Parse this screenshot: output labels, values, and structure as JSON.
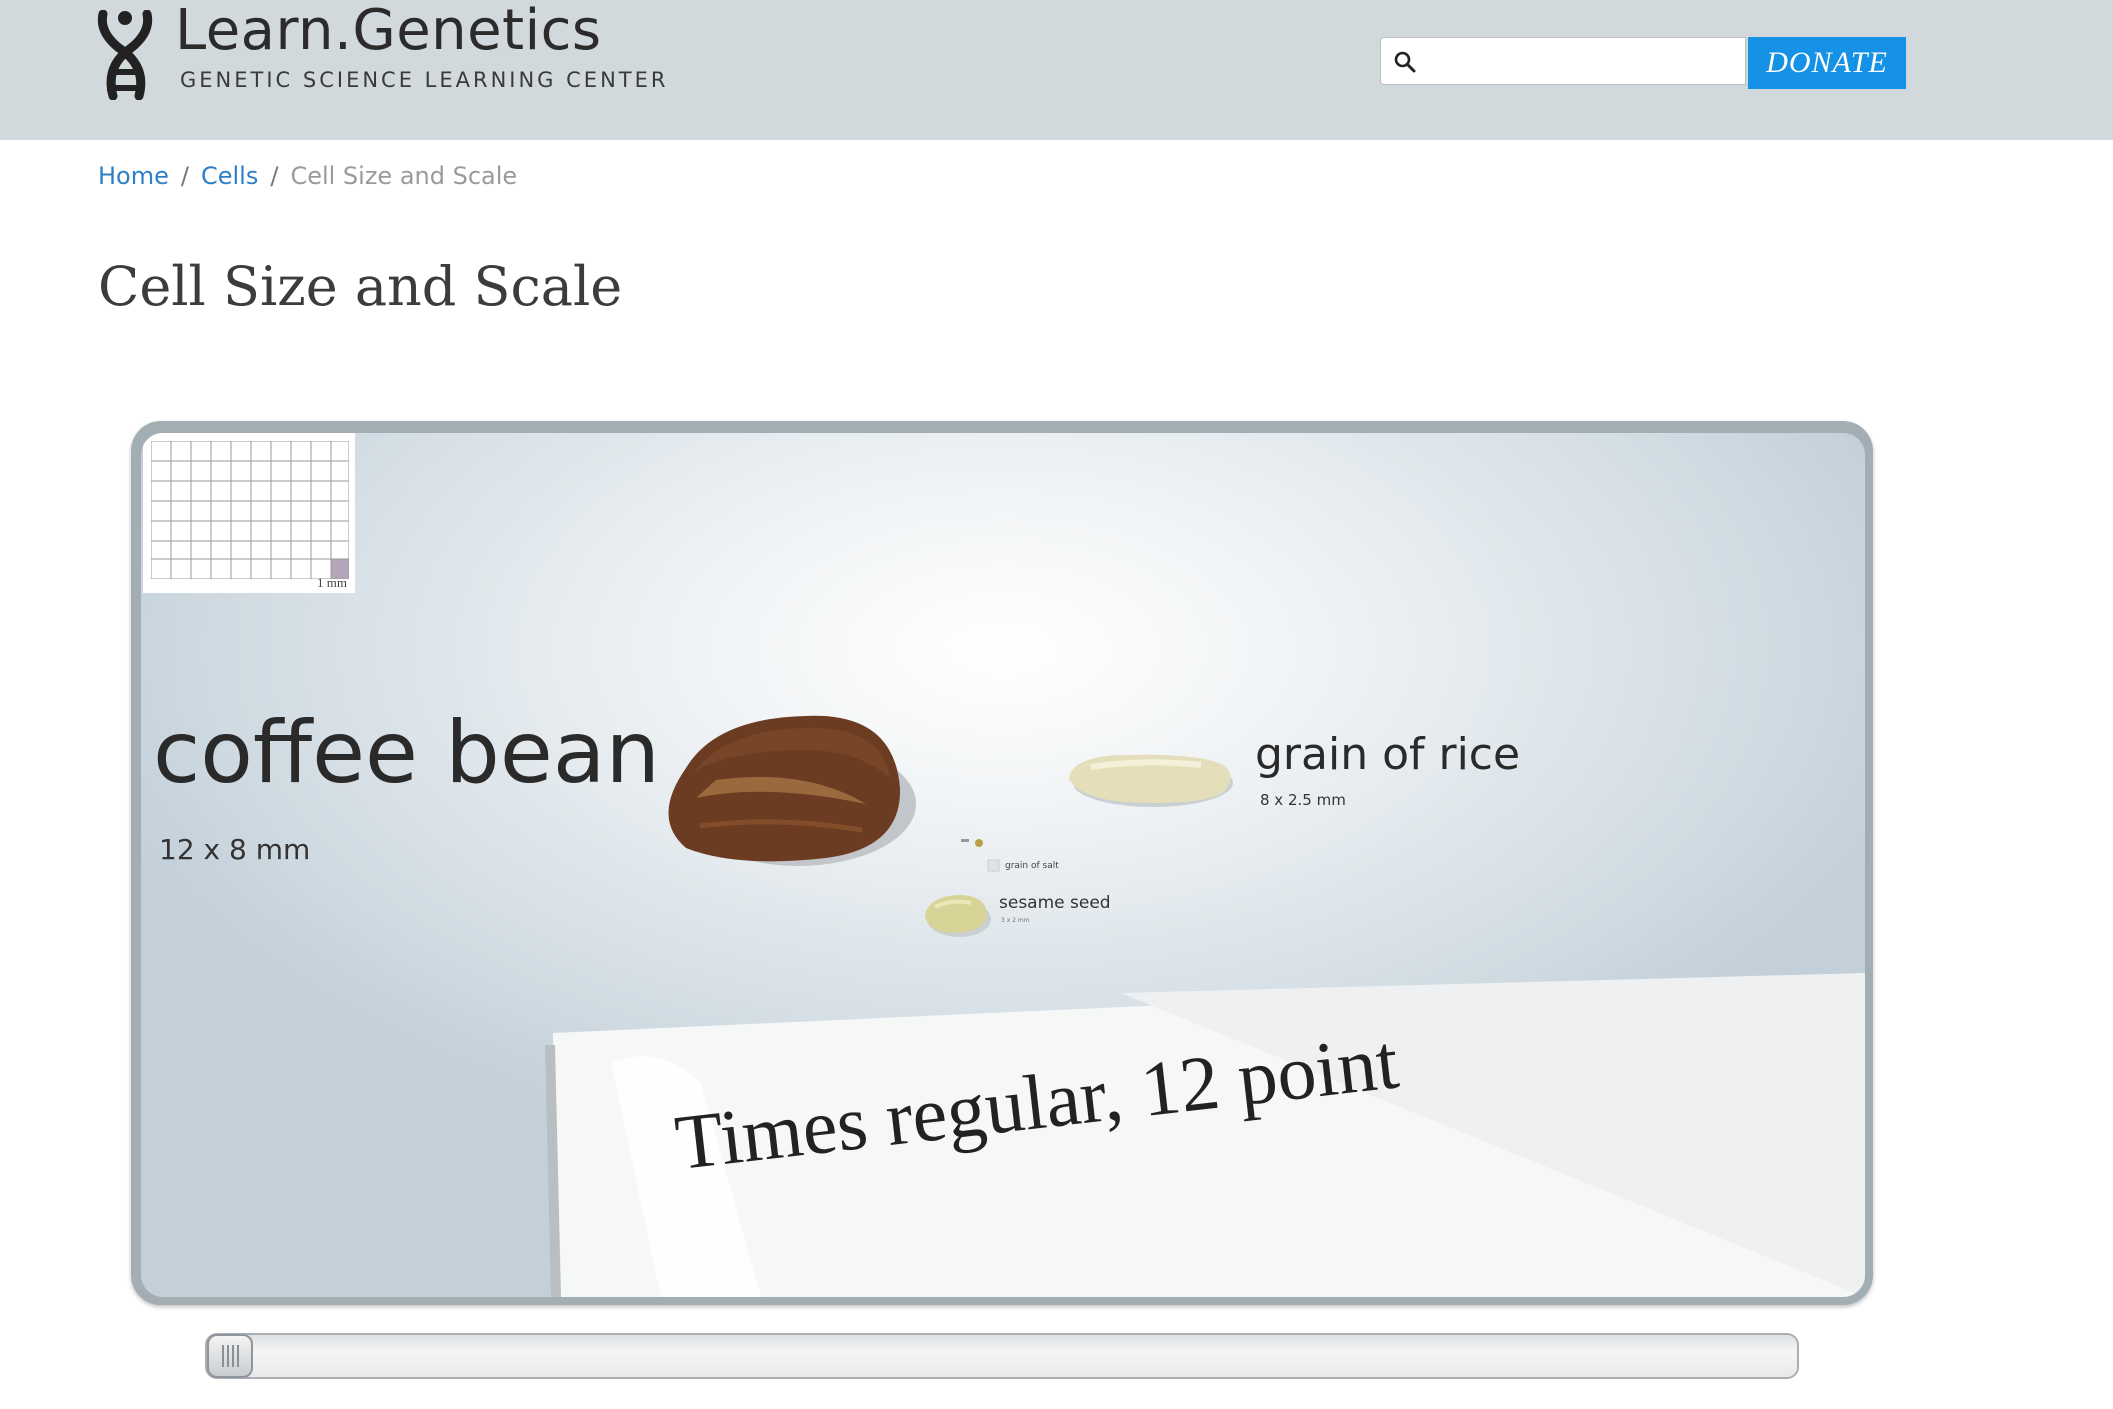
{
  "header": {
    "site_title": "Learn.Genetics",
    "site_subtitle": "GENETIC SCIENCE LEARNING CENTER",
    "search": {
      "placeholder": "",
      "value": ""
    },
    "donate_label": "DONATE"
  },
  "breadcrumb": {
    "home": "Home",
    "separator": "/",
    "cells": "Cells",
    "current": "Cell Size and Scale"
  },
  "page_title": "Cell Size and Scale",
  "viewer": {
    "grid_unit": "1 mm",
    "specimens": {
      "coffee_bean": {
        "name": "coffee bean",
        "size": "12 x 8 mm"
      },
      "rice": {
        "name": "grain of rice",
        "size": "8 x 2.5 mm"
      },
      "salt": {
        "name": "grain of salt"
      },
      "sesame": {
        "name": "sesame seed",
        "size": "3 x 2 mm"
      }
    },
    "paper_text": "Times regular, 12 point"
  },
  "slider": {
    "value": 0
  },
  "colors": {
    "header_bg": "#d1d9dc",
    "donate_bg": "#1592e6",
    "link": "#2f7fc6"
  },
  "icons": [
    "dna-logo-icon",
    "search-icon",
    "slider-grip-icon"
  ]
}
